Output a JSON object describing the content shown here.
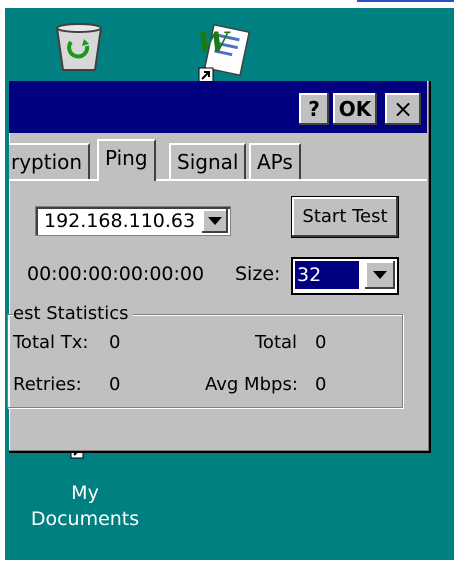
{
  "desktop": {
    "icons": [
      {
        "name": "recycle-bin"
      },
      {
        "name": "word-document-shortcut"
      },
      {
        "label": "My\nDocuments"
      }
    ],
    "mydocs_line1": "My",
    "mydocs_line2": "Documents"
  },
  "dialog": {
    "title_buttons": {
      "help": "?",
      "ok": "OK",
      "close": "×"
    },
    "tabs": [
      {
        "label": "ryption"
      },
      {
        "label": "Ping",
        "active": true
      },
      {
        "label": "Signal"
      },
      {
        "label": "APs"
      }
    ],
    "ip_address": "192.168.110.63",
    "start_test": "Start Test",
    "mac_address": "00:00:00:00:00:00",
    "size_label": "Size:",
    "size_value": "32",
    "stats": {
      "legend": "est Statistics",
      "total_tx_label": "Total Tx:",
      "total_tx_value": "0",
      "total_label": "Total",
      "total_value": "0",
      "retries_label": "Retries:",
      "retries_value": "0",
      "avg_mbps_label": "Avg Mbps:",
      "avg_mbps_value": "0"
    }
  },
  "colors": {
    "desktop": "#008080",
    "titlebar": "#000080",
    "face": "#c0c0c0"
  }
}
